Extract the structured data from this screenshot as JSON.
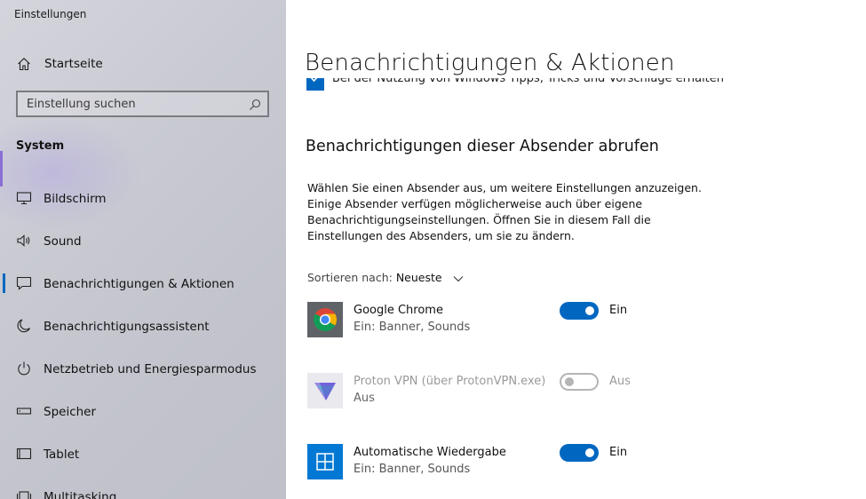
{
  "window": {
    "title": "Einstellungen"
  },
  "sidebar": {
    "home_label": "Startseite",
    "search_placeholder": "Einstellung suchen",
    "section_label": "System",
    "items": [
      {
        "label": "Bildschirm",
        "icon": "monitor-icon"
      },
      {
        "label": "Sound",
        "icon": "speaker-icon"
      },
      {
        "label": "Benachrichtigungen & Aktionen",
        "icon": "notification-icon",
        "active": true
      },
      {
        "label": "Benachrichtigungsassistent",
        "icon": "moon-icon"
      },
      {
        "label": "Netzbetrieb und Energiesparmodus",
        "icon": "power-icon"
      },
      {
        "label": "Speicher",
        "icon": "storage-icon"
      },
      {
        "label": "Tablet",
        "icon": "tablet-icon"
      },
      {
        "label": "Multitasking",
        "icon": "multitasking-icon"
      }
    ]
  },
  "main": {
    "page_title": "Benachrichtigungen & Aktionen",
    "clipped_option": "Bei der Nutzung von Windows Tipps, Tricks und Vorschläge erhalten",
    "senders_title": "Benachrichtigungen dieser Absender abrufen",
    "description": "Wählen Sie einen Absender aus, um weitere Einstellungen anzuzeigen. Einige Absender verfügen möglicherweise auch über eigene Benachrichtigungseinstellungen. Öffnen Sie in diesem Fall die Einstellungen des Absenders, um sie zu ändern.",
    "sort_label": "Sortieren nach:",
    "sort_value": "Neueste",
    "apps": [
      {
        "name": "Google Chrome",
        "sub": "Ein: Banner, Sounds",
        "toggle_label": "Ein",
        "on": true,
        "icon": "chrome-icon"
      },
      {
        "name": "Proton VPN (über ProtonVPN.exe)",
        "sub": "Aus",
        "toggle_label": "Aus",
        "on": false,
        "icon": "protonvpn-icon"
      },
      {
        "name": "Automatische Wiedergabe",
        "sub": "Ein: Banner, Sounds",
        "toggle_label": "Ein",
        "on": true,
        "icon": "autoplay-icon"
      }
    ]
  },
  "colors": {
    "accent": "#0067c0",
    "sidebar_bg": "#c8c9d1"
  }
}
